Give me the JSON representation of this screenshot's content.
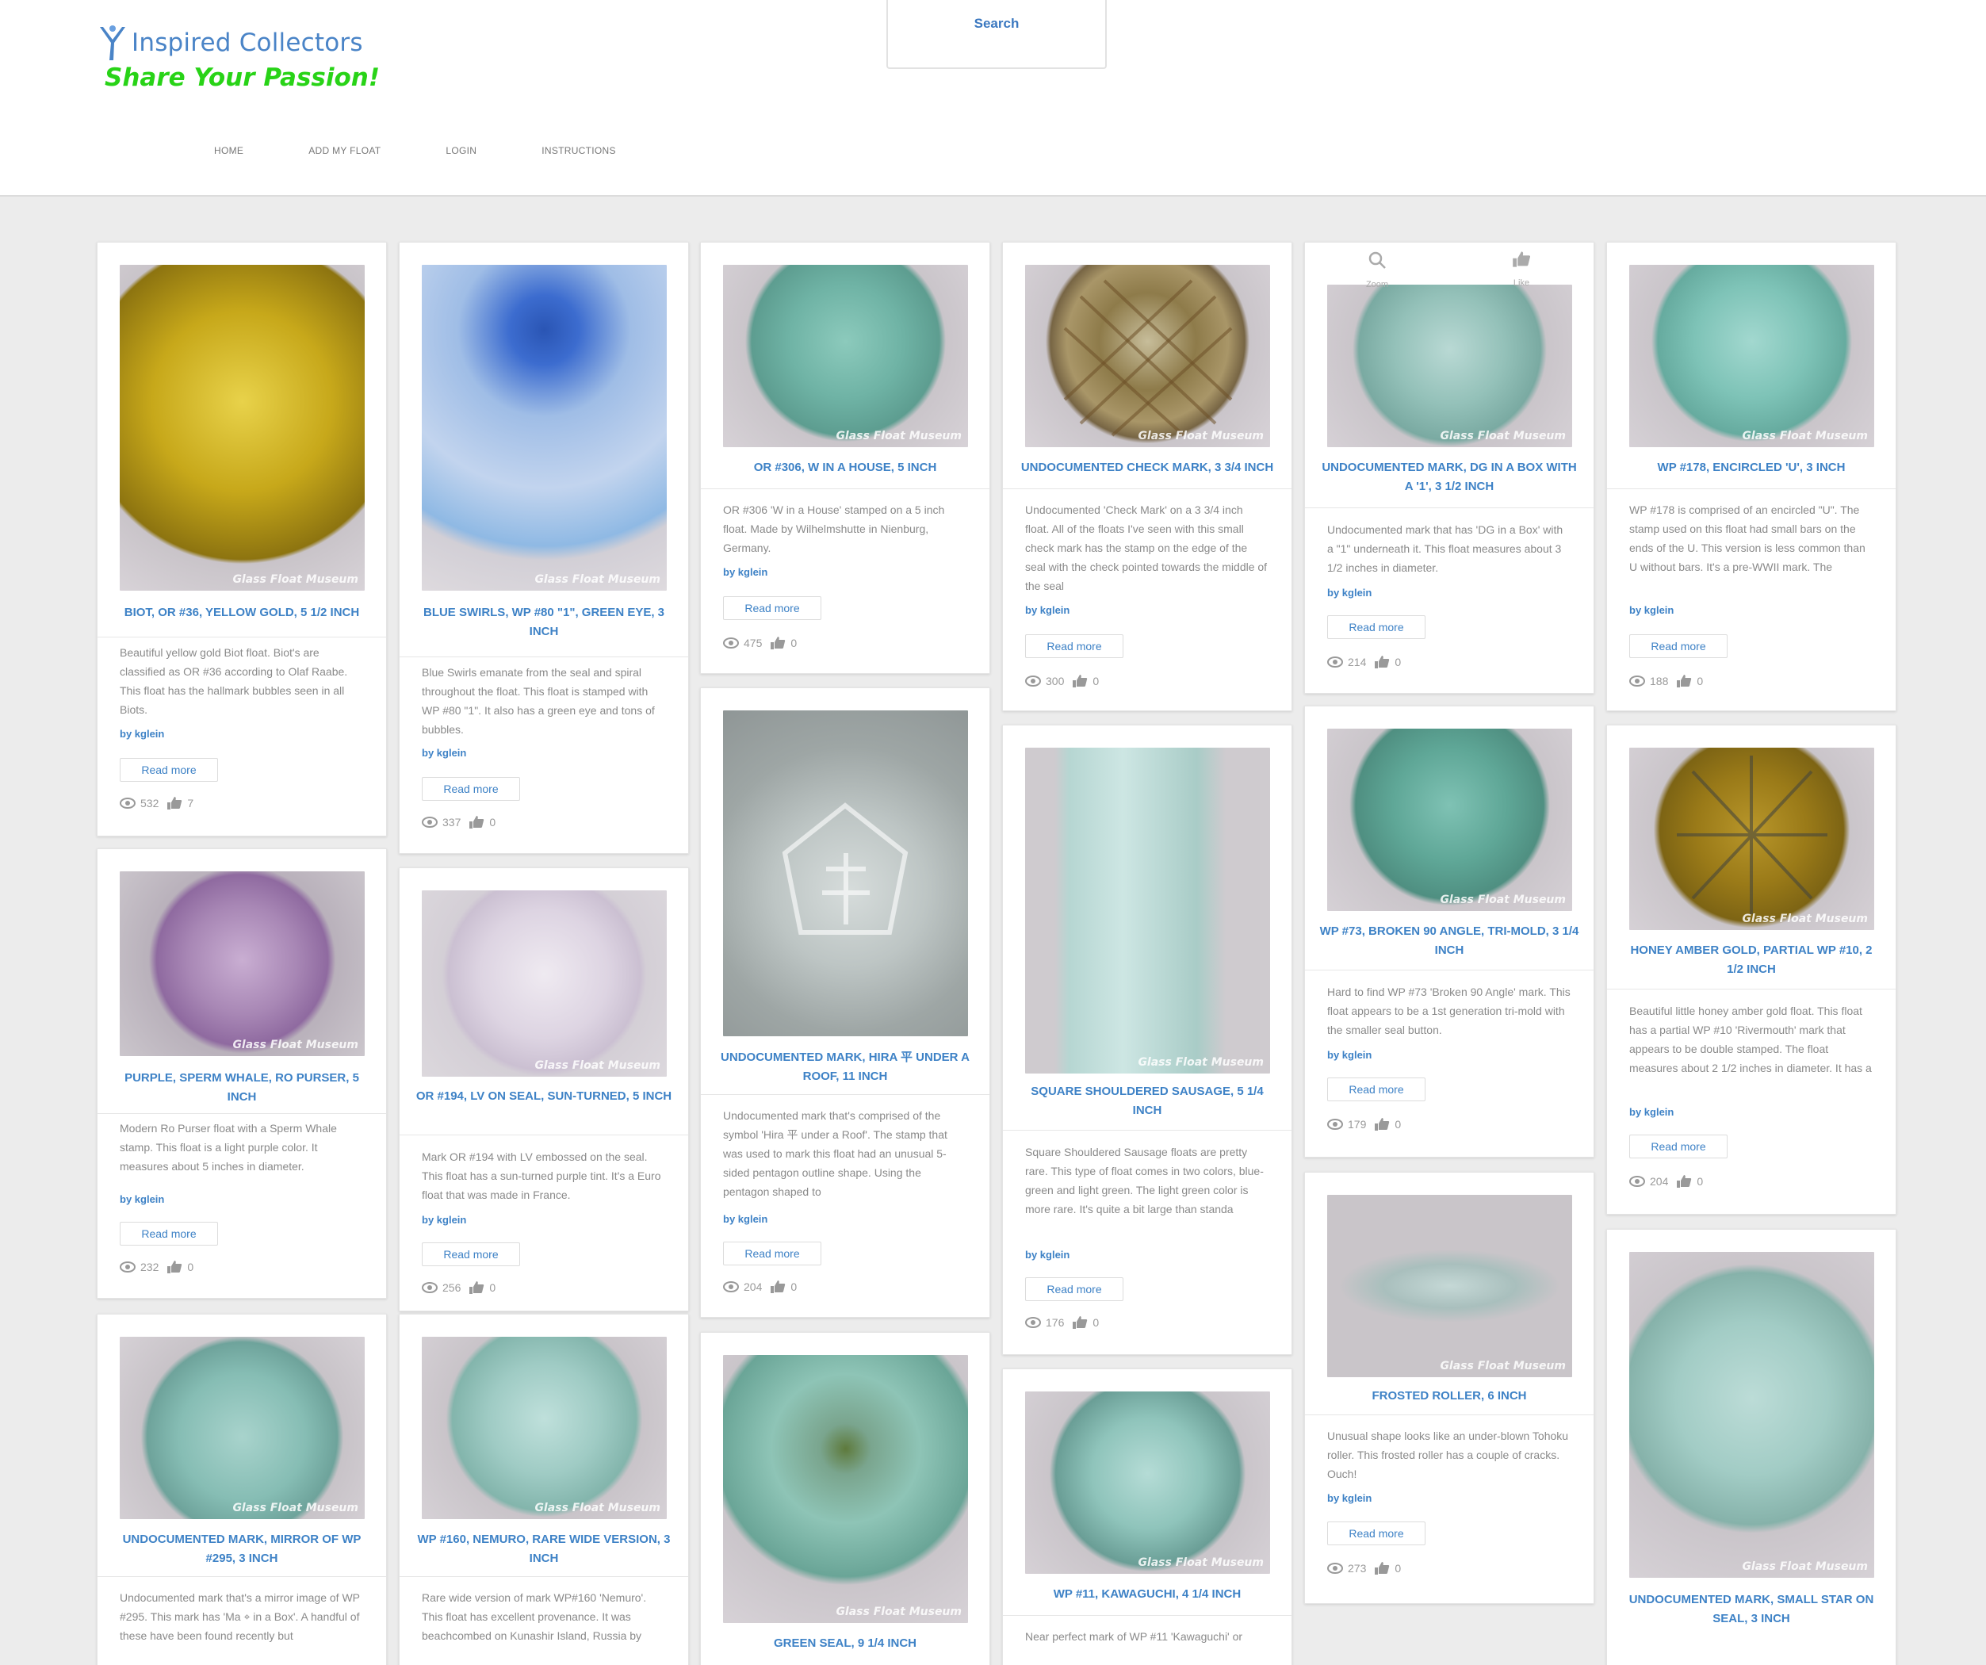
{
  "site": {
    "brand": "Inspired Collectors",
    "tagline": "Share Your Passion!",
    "search_label": "Search",
    "nav": [
      "HOME",
      "ADD MY FLOAT",
      "LOGIN",
      "INSTRUCTIONS"
    ]
  },
  "hover_tools": {
    "zoom": "Zoom",
    "like": "Like"
  },
  "watermark": "Glass Float Museum",
  "cards": [
    {
      "title": "BIOT, OR #36, YELLOW GOLD, 5 1/2 INCH",
      "desc": "Beautiful yellow gold Biot float.   Biot's are classified as OR #36 according to Olaf Raabe.   This float has the hallmark bubbles seen in all Biots.",
      "by": "by kglein",
      "btn": "Read more",
      "views": "532",
      "likes": "7"
    },
    {
      "title": "BLUE SWIRLS, WP #80 \"1\", GREEN EYE, 3 INCH",
      "desc": "Blue Swirls emanate from the seal and spiral throughout the float.   This float is stamped with WP #80 \"1\".   It also has a green eye and tons of bubbles.",
      "by": "by kglein",
      "btn": "Read more",
      "views": "337",
      "likes": "0"
    },
    {
      "title": "OR #306, W IN A HOUSE, 5 INCH",
      "desc": "OR #306 'W in a House' stamped on a 5 inch float.   Made by Wilhelmshutte in Nienburg, Germany.",
      "by": "by kglein",
      "btn": "Read more",
      "views": "475",
      "likes": "0"
    },
    {
      "title": "UNDOCUMENTED CHECK MARK, 3 3/4 INCH",
      "desc": "Undocumented 'Check Mark' on a 3 3/4 inch float.   All of the floats I've seen with this small check mark has the stamp on the edge of the seal with the check pointed towards the middle of the seal",
      "by": "by kglein",
      "btn": "Read more",
      "views": "300",
      "likes": "0"
    },
    {
      "title": "UNDOCUMENTED MARK, DG IN A BOX WITH A '1', 3 1/2 INCH",
      "desc": "Undocumented mark that has 'DG in a Box' with a \"1\" underneath it.   This float measures about 3 1/2 inches in diameter.",
      "by": "by kglein",
      "btn": "Read more",
      "views": "214",
      "likes": "0"
    },
    {
      "title": "WP #178, ENCIRCLED 'U', 3 INCH",
      "desc": "WP #178 is comprised of an encircled \"U\".   The stamp used on this float had small bars on the ends of the U.  This version is less common than U without bars.   It's a pre-WWII mark.   The",
      "by": "by kglein",
      "btn": "Read more",
      "views": "188",
      "likes": "0"
    },
    {
      "title": "PURPLE, SPERM WHALE, RO PURSER, 5 INCH",
      "desc": "Modern Ro Purser float with a Sperm Whale stamp.   This float is a light purple color.   It measures about 5 inches in diameter.",
      "by": "by kglein",
      "btn": "Read more",
      "views": "232",
      "likes": "0"
    },
    {
      "title": "OR #194, LV ON SEAL, SUN-TURNED, 5 INCH",
      "desc": "Mark OR #194 with LV embossed on the seal.   This float has a sun-turned purple tint.   It's a Euro float that was made in France.",
      "by": "by kglein",
      "btn": "Read more",
      "views": "256",
      "likes": "0"
    },
    {
      "title": "UNDOCUMENTED MARK, HIRA 平 UNDER A ROOF, 11 INCH",
      "desc": "Undocumented mark that's comprised of the symbol 'Hira 平 under a Roof'.   The stamp that was used to mark this float had an unusual 5-sided pentagon outline shape.   Using the pentagon shaped to",
      "by": "by kglein",
      "btn": "Read more",
      "views": "204",
      "likes": "0"
    },
    {
      "title": "SQUARE SHOULDERED SAUSAGE, 5 1/4 INCH",
      "desc": "Square Shouldered Sausage floats are pretty rare.   This type of float comes in two colors, blue-green and light green.   The light green color is more rare.   It's quite a bit large than standa",
      "by": "by kglein",
      "btn": "Read more",
      "views": "176",
      "likes": "0"
    },
    {
      "title": "WP #73, BROKEN 90 ANGLE, TRI-MOLD, 3 1/4 INCH",
      "desc": "Hard to find WP #73 'Broken 90 Angle' mark.   This float appears to be a 1st generation tri-mold with the smaller seal button.",
      "by": "by kglein",
      "btn": "Read more",
      "views": "179",
      "likes": "0"
    },
    {
      "title": "HONEY AMBER GOLD, PARTIAL WP #10, 2 1/2 INCH",
      "desc": "Beautiful little honey amber gold float.   This float has a partial WP #10 'Rivermouth' mark that appears to be double stamped.   The float measures about 2 1/2 inches in diameter.   It has a",
      "by": "by kglein",
      "btn": "Read more",
      "views": "204",
      "likes": "0"
    },
    {
      "title": "FROSTED ROLLER, 6 INCH",
      "desc": "Unusual shape looks like an under-blown Tohoku roller.   This frosted roller has a couple of cracks.   Ouch!",
      "by": "by kglein",
      "btn": "Read more",
      "views": "273",
      "likes": "0"
    },
    {
      "title": "UNDOCUMENTED MARK, MIRROR OF WP #295, 3 INCH",
      "desc": "Undocumented mark that's a mirror image of WP #295.   This mark has 'Ma ⌖ in a Box'.   A handful of these have been found recently but"
    },
    {
      "title": "WP #160, NEMURO, RARE WIDE VERSION, 3 INCH",
      "desc": "Rare wide version of mark WP#160 'Nemuro'.   This float has excellent provenance.  It was beachcombed on Kunashir Island, Russia by"
    },
    {
      "title": "GREEN SEAL, 9 1/4 INCH"
    },
    {
      "title": "WP #11, KAWAGUCHI, 4 1/4 INCH",
      "desc": "Near perfect mark of WP #11 'Kawaguchi' or"
    },
    {
      "title": "UNDOCUMENTED MARK, SMALL STAR ON SEAL, 3 INCH"
    }
  ]
}
